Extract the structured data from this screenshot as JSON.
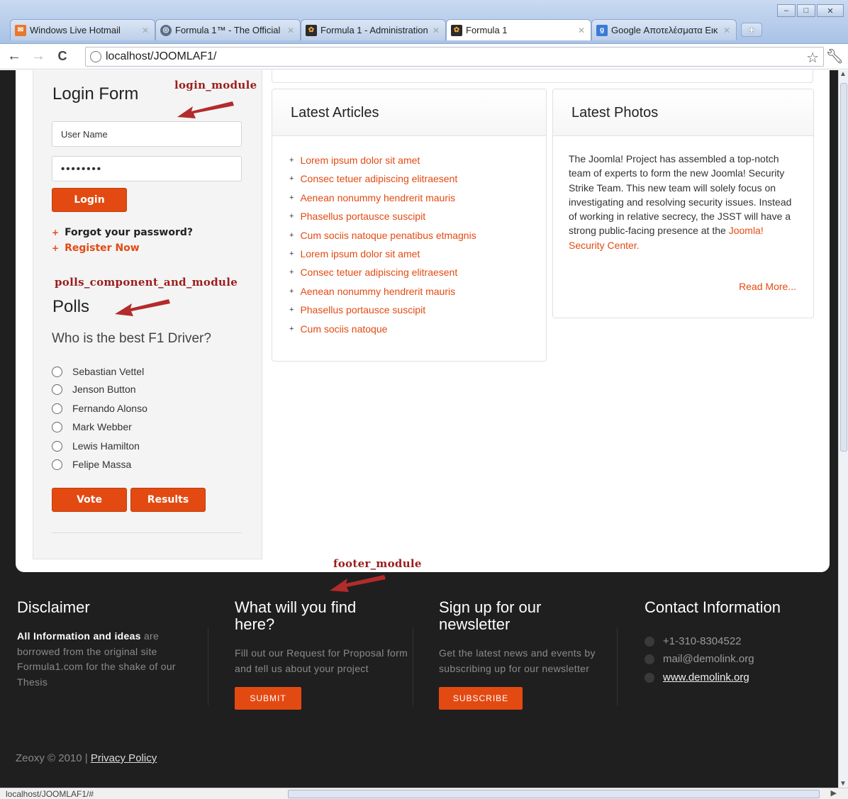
{
  "browser": {
    "tabs": [
      {
        "label": "Windows Live Hotmail",
        "icon": "hotmail-icon",
        "color": "#e8772e"
      },
      {
        "label": "Formula 1™ - The Official",
        "icon": "globe-icon",
        "color": "#5a6f8a"
      },
      {
        "label": "Formula 1 - Administration",
        "icon": "joomla-icon",
        "color": "#2b2b2b"
      },
      {
        "label": "Formula 1",
        "icon": "joomla-icon",
        "color": "#2b2b2b"
      },
      {
        "label": "Google Αποτελέσματα Εικ",
        "icon": "google-icon",
        "color": "#3a7bd5"
      }
    ],
    "url": "localhost/JOOMLAF1/",
    "status_url": "localhost/JOOMLAF1/#"
  },
  "annotations": {
    "login": "login_module",
    "polls": "polls_component_and_module",
    "footer": "footer_module"
  },
  "login": {
    "title": "Login Form",
    "username_placeholder": "User Name",
    "password_value": "••••••••",
    "login_label": "Login",
    "forgot_label": "Forgot your password?",
    "register_label": "Register Now"
  },
  "polls": {
    "title": "Polls",
    "question": "Who is the best F1 Driver?",
    "options": [
      "Sebastian Vettel",
      "Jenson Button",
      "Fernando Alonso",
      "Mark Webber",
      "Lewis Hamilton",
      "Felipe Massa"
    ],
    "vote_label": "Vote",
    "results_label": "Results"
  },
  "latest_articles": {
    "title": "Latest Articles",
    "items": [
      "Lorem ipsum dolor sit amet",
      "Consec tetuer adipiscing elitraesent",
      "Aenean nonummy hendrerit mauris",
      "Phasellus portausce suscipit",
      "Cum sociis natoque penatibus etmagnis",
      "Lorem ipsum dolor sit amet",
      "Consec tetuer adipiscing elitraesent",
      "Aenean nonummy hendrerit mauris",
      "Phasellus portausce suscipit",
      "Cum sociis natoque"
    ]
  },
  "latest_photos": {
    "title": "Latest Photos",
    "text": "The Joomla! Project has assembled a top-notch team of experts to form the new Joomla! Security Strike Team. This new team will solely focus on investigating and resolving security issues. Instead of working in relative secrecy, the JSST will have a strong public-facing presence at the",
    "link_text": "Joomla! Security Center.",
    "read_more": "Read More..."
  },
  "footer": {
    "disclaimer": {
      "title": "Disclaimer",
      "bold": "All Information and ideas",
      "text": " are borrowed from the original site Formula1.com for the shake of our Thesis"
    },
    "find": {
      "title": "What will you find here?",
      "text": "Fill out our Request for Proposal form and tell us about your project",
      "button": "SUBMIT"
    },
    "newsletter": {
      "title": "Sign up for our newsletter",
      "text": "Get the latest news and events by subscribing up for our newsletter",
      "button": "SUBSCRIBE"
    },
    "contact": {
      "title": "Contact Information",
      "phone": "+1-310-8304522",
      "email": "mail@demolink.org",
      "website": "www.demolink.org"
    },
    "copyright": "Zeoxy © 2010 | ",
    "privacy": "Privacy Policy"
  },
  "colors": {
    "accent": "#e34a12",
    "annotation": "#9b1c1c",
    "footer_bg": "#1f1f1f"
  }
}
